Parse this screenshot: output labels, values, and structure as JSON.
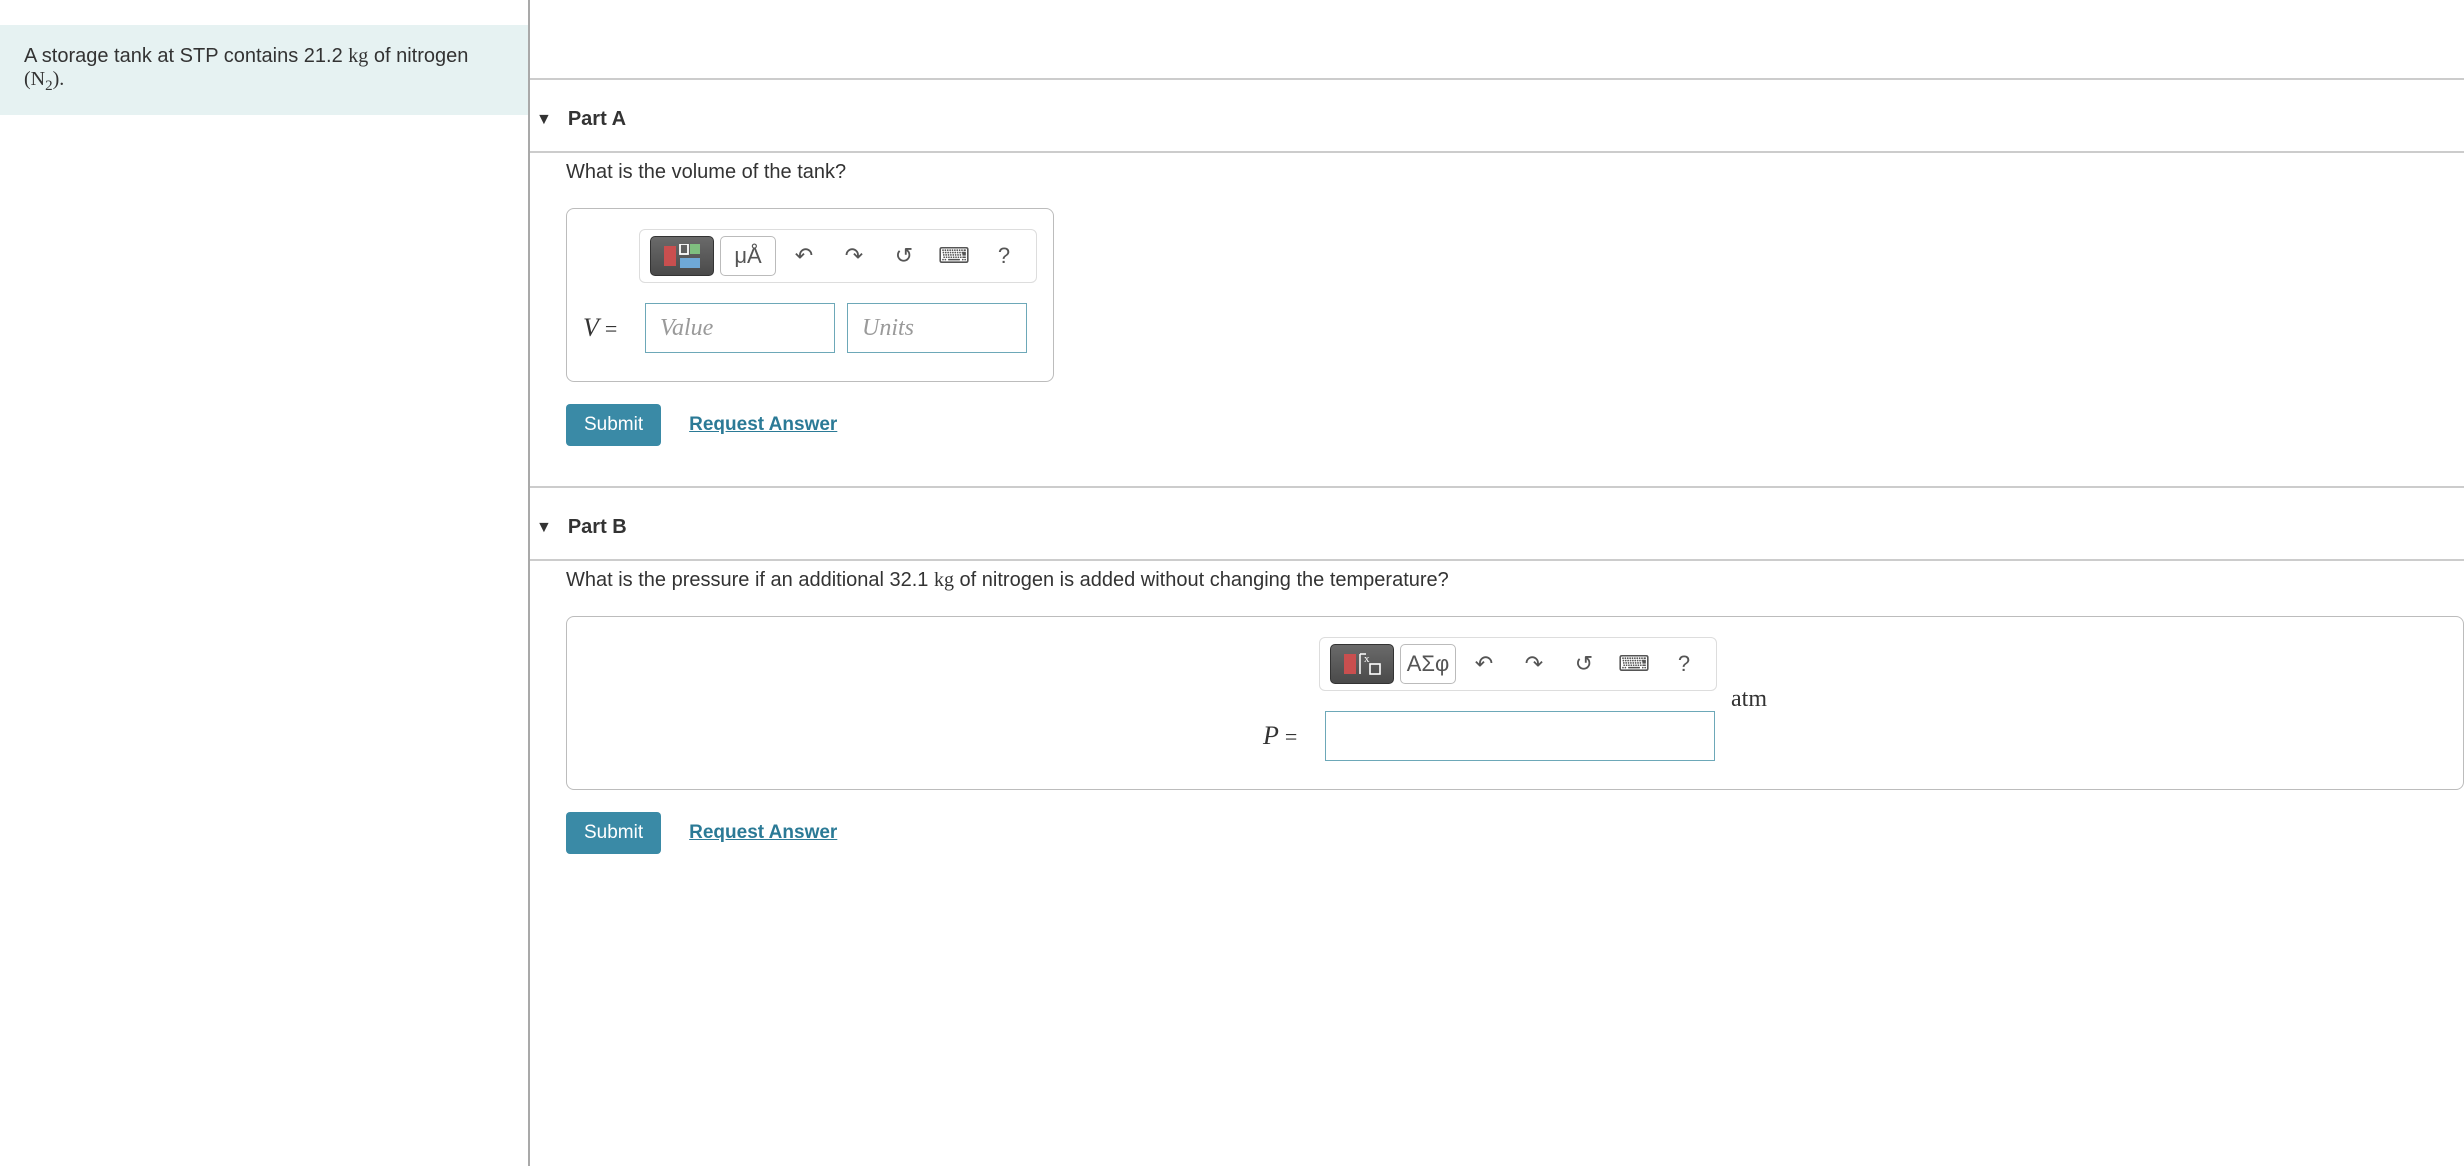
{
  "problem": {
    "prefix": "A storage tank at STP contains 21.2 ",
    "mass_unit": "kg",
    "middle": " of nitrogen ",
    "formula_open": "(N",
    "formula_sub": "2",
    "formula_close": ")."
  },
  "parts": [
    {
      "title": "Part A",
      "question_plain": "What is the volume of the tank?",
      "variable": "V",
      "value_placeholder": "Value",
      "units_placeholder": "Units",
      "has_units_input": true,
      "toolbar_second_label": "μÅ"
    },
    {
      "title": "Part B",
      "question_prefix": "What is the pressure if an additional 32.1 ",
      "question_unit": "kg",
      "question_suffix": " of nitrogen is added without changing the temperature?",
      "variable": "P",
      "unit_tail": "atm",
      "has_units_input": false,
      "toolbar_second_label": "ΑΣφ"
    }
  ],
  "buttons": {
    "submit": "Submit",
    "request_answer": "Request Answer",
    "help": "?"
  }
}
